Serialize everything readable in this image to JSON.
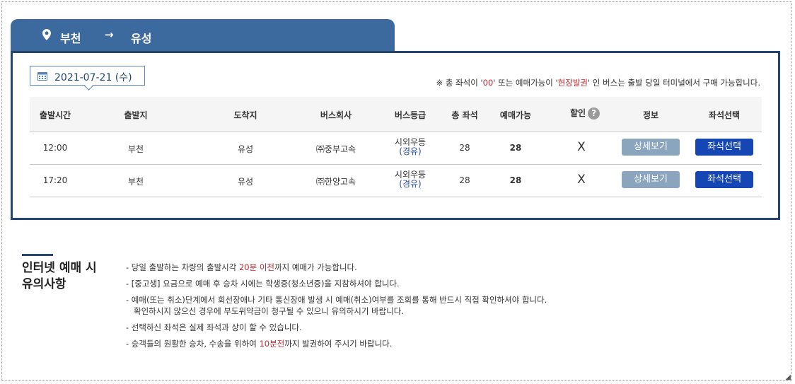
{
  "route": {
    "from": "부천",
    "arrow": "→",
    "to": "유성"
  },
  "date": {
    "label": "2021-07-21 (수)"
  },
  "notice": {
    "prefix": "※ 총 좌석이 '",
    "zero": "00",
    "mid": "' 또는 예매가능이 '",
    "onsite": "현장발권",
    "suffix": "' 인 버스는 출발 당일 터미널에서 구매 가능합니다."
  },
  "table": {
    "headers": {
      "depart_time": "출발시간",
      "origin": "출발지",
      "destination": "도착지",
      "company": "버스회사",
      "grade": "버스등급",
      "total_seats": "총 좌석",
      "available": "예매가능",
      "discount": "할인",
      "info": "정보",
      "seat_select": "좌석선택"
    },
    "rows": [
      {
        "time": "12:00",
        "origin": "부천",
        "destination": "유성",
        "company": "㈜중부고속",
        "grade": "시외우등",
        "grade_route": "(경유)",
        "total": "28",
        "available": "28",
        "discount": "X",
        "detail": "상세보기",
        "select": "좌석선택"
      },
      {
        "time": "17:20",
        "origin": "부천",
        "destination": "유성",
        "company": "㈜한양고속",
        "grade": "시외우등",
        "grade_route": "(경유)",
        "total": "28",
        "available": "28",
        "discount": "X",
        "detail": "상세보기",
        "select": "좌석선택"
      }
    ]
  },
  "notes": {
    "title_line1": "인터넷 예매 시",
    "title_line2": "유의사항",
    "item1_a": "- 당일 출발하는 차량의 출발시각 ",
    "item1_red": "20분 이전",
    "item1_b": "까지 예매가 가능합니다.",
    "item2": "- [중고생] 요금으로 예매 후 승차 시에는 학생증(청소년증)을 지참하셔야 합니다.",
    "item3_line1": "- 예매(또는 취소)단계에서 회선장애나 기타 통신장애 발생 시 예매(취소)여부를 조회를 통해 반드시 직접 확인하셔야 합니다.",
    "item3_line2": "확인하시지 않으신 경우에 부도위약금이 청구될 수 있으니 유의하시기 바랍니다.",
    "item4": "- 선택하신 좌석은 실제 좌석과 상이 할 수 있습니다.",
    "item5_a": "- 승객들의 원활한 승차, 수송을 위하여 ",
    "item5_red": "10분전",
    "item5_b": "까지 발권하여 주시기 바랍니다."
  }
}
